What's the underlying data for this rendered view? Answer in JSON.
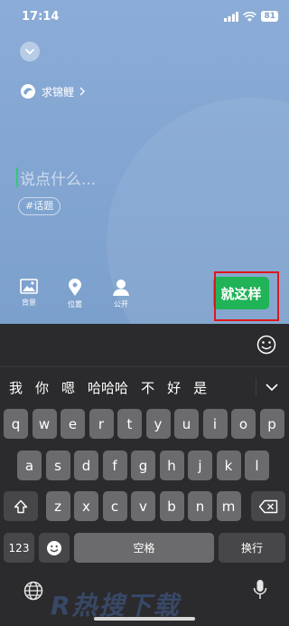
{
  "status": {
    "time": "17:14",
    "battery": "81"
  },
  "editor": {
    "mode_label": "求锦鲤",
    "placeholder": "说点什么...",
    "topic_chip": "#话题"
  },
  "toolbar": {
    "background_label": "背景",
    "location_label": "位置",
    "visibility_label": "公开",
    "publish_label": "就这样"
  },
  "keyboard": {
    "candidates": [
      "我",
      "你",
      "嗯",
      "哈哈哈",
      "不",
      "好",
      "是"
    ],
    "rows": [
      [
        "q",
        "w",
        "e",
        "r",
        "t",
        "y",
        "u",
        "i",
        "o",
        "p"
      ],
      [
        "a",
        "s",
        "d",
        "f",
        "g",
        "h",
        "j",
        "k",
        "l"
      ],
      [
        "z",
        "x",
        "c",
        "v",
        "b",
        "n",
        "m"
      ]
    ],
    "numbers_key": "123",
    "space_key": "空格",
    "return_key": "换行"
  },
  "watermark": "R热搜下载",
  "colors": {
    "accent": "#21b357",
    "highlight": "#e0171b"
  }
}
